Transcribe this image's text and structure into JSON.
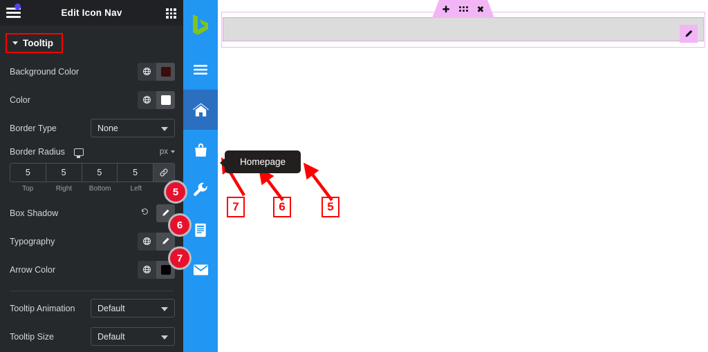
{
  "panel": {
    "header": {
      "title": "Edit Icon Nav",
      "menu_icon": "hamburger-icon",
      "badge_dot_color": "#5243f5",
      "grid_icon": "grid-apps-icon"
    },
    "section": {
      "label": "Tooltip",
      "caret": "caret-down-icon",
      "highlight_color": "#ff0000"
    },
    "controls": [
      {
        "label": "Background Color",
        "type": "color",
        "globe_icon": "globe-icon",
        "swatch": "#3b0d0d"
      },
      {
        "label": "Color",
        "type": "color",
        "globe_icon": "globe-icon",
        "swatch": "#ffffff"
      },
      {
        "label": "Border Type",
        "type": "select",
        "value": "None"
      }
    ],
    "border_radius": {
      "label": "Border Radius",
      "device_icon": "monitor-icon",
      "unit": "px",
      "unit_caret": "caret-down-icon",
      "link_icon": "link-icon",
      "values": [
        "5",
        "5",
        "5",
        "5"
      ],
      "sides": [
        "Top",
        "Right",
        "Bottom",
        "Left"
      ]
    },
    "box_shadow": {
      "label": "Box Shadow",
      "reset_icon": "reset-icon",
      "edit_icon": "pencil-icon"
    },
    "typography": {
      "label": "Typography",
      "globe_icon": "globe-icon",
      "edit_icon": "pencil-icon"
    },
    "arrow_color": {
      "label": "Arrow Color",
      "globe_icon": "globe-icon",
      "swatch": "#000000"
    },
    "tooltip_animation": {
      "label": "Tooltip Animation",
      "value": "Default"
    },
    "tooltip_size": {
      "label": "Tooltip Size",
      "value": "Default"
    }
  },
  "badges": [
    {
      "number": "5"
    },
    {
      "number": "6"
    },
    {
      "number": "7"
    }
  ],
  "iconnav": {
    "background": "#2196f3",
    "active_background": "#2a6fc0",
    "logo": "bing-logo-icon",
    "logo_color": "#7fc41c",
    "items": [
      {
        "icon": "hamburger-icon",
        "active": false
      },
      {
        "icon": "home-icon",
        "active": true
      },
      {
        "icon": "shopping-bag-icon",
        "active": false
      },
      {
        "icon": "wrench-icon",
        "active": false
      },
      {
        "icon": "book-icon",
        "active": false
      },
      {
        "icon": "envelope-icon",
        "active": false
      }
    ]
  },
  "canvas": {
    "widget_toolbar": {
      "add_icon": "plus-icon",
      "drag_icon": "drag-dots-icon",
      "close_icon": "close-icon",
      "color": "#f2b6f7"
    },
    "edit_pencil": "pencil-icon",
    "tooltip_text": "Homepage",
    "tooltip_background": "#231f1f",
    "callouts": [
      {
        "number": "7"
      },
      {
        "number": "6"
      },
      {
        "number": "5"
      }
    ]
  }
}
